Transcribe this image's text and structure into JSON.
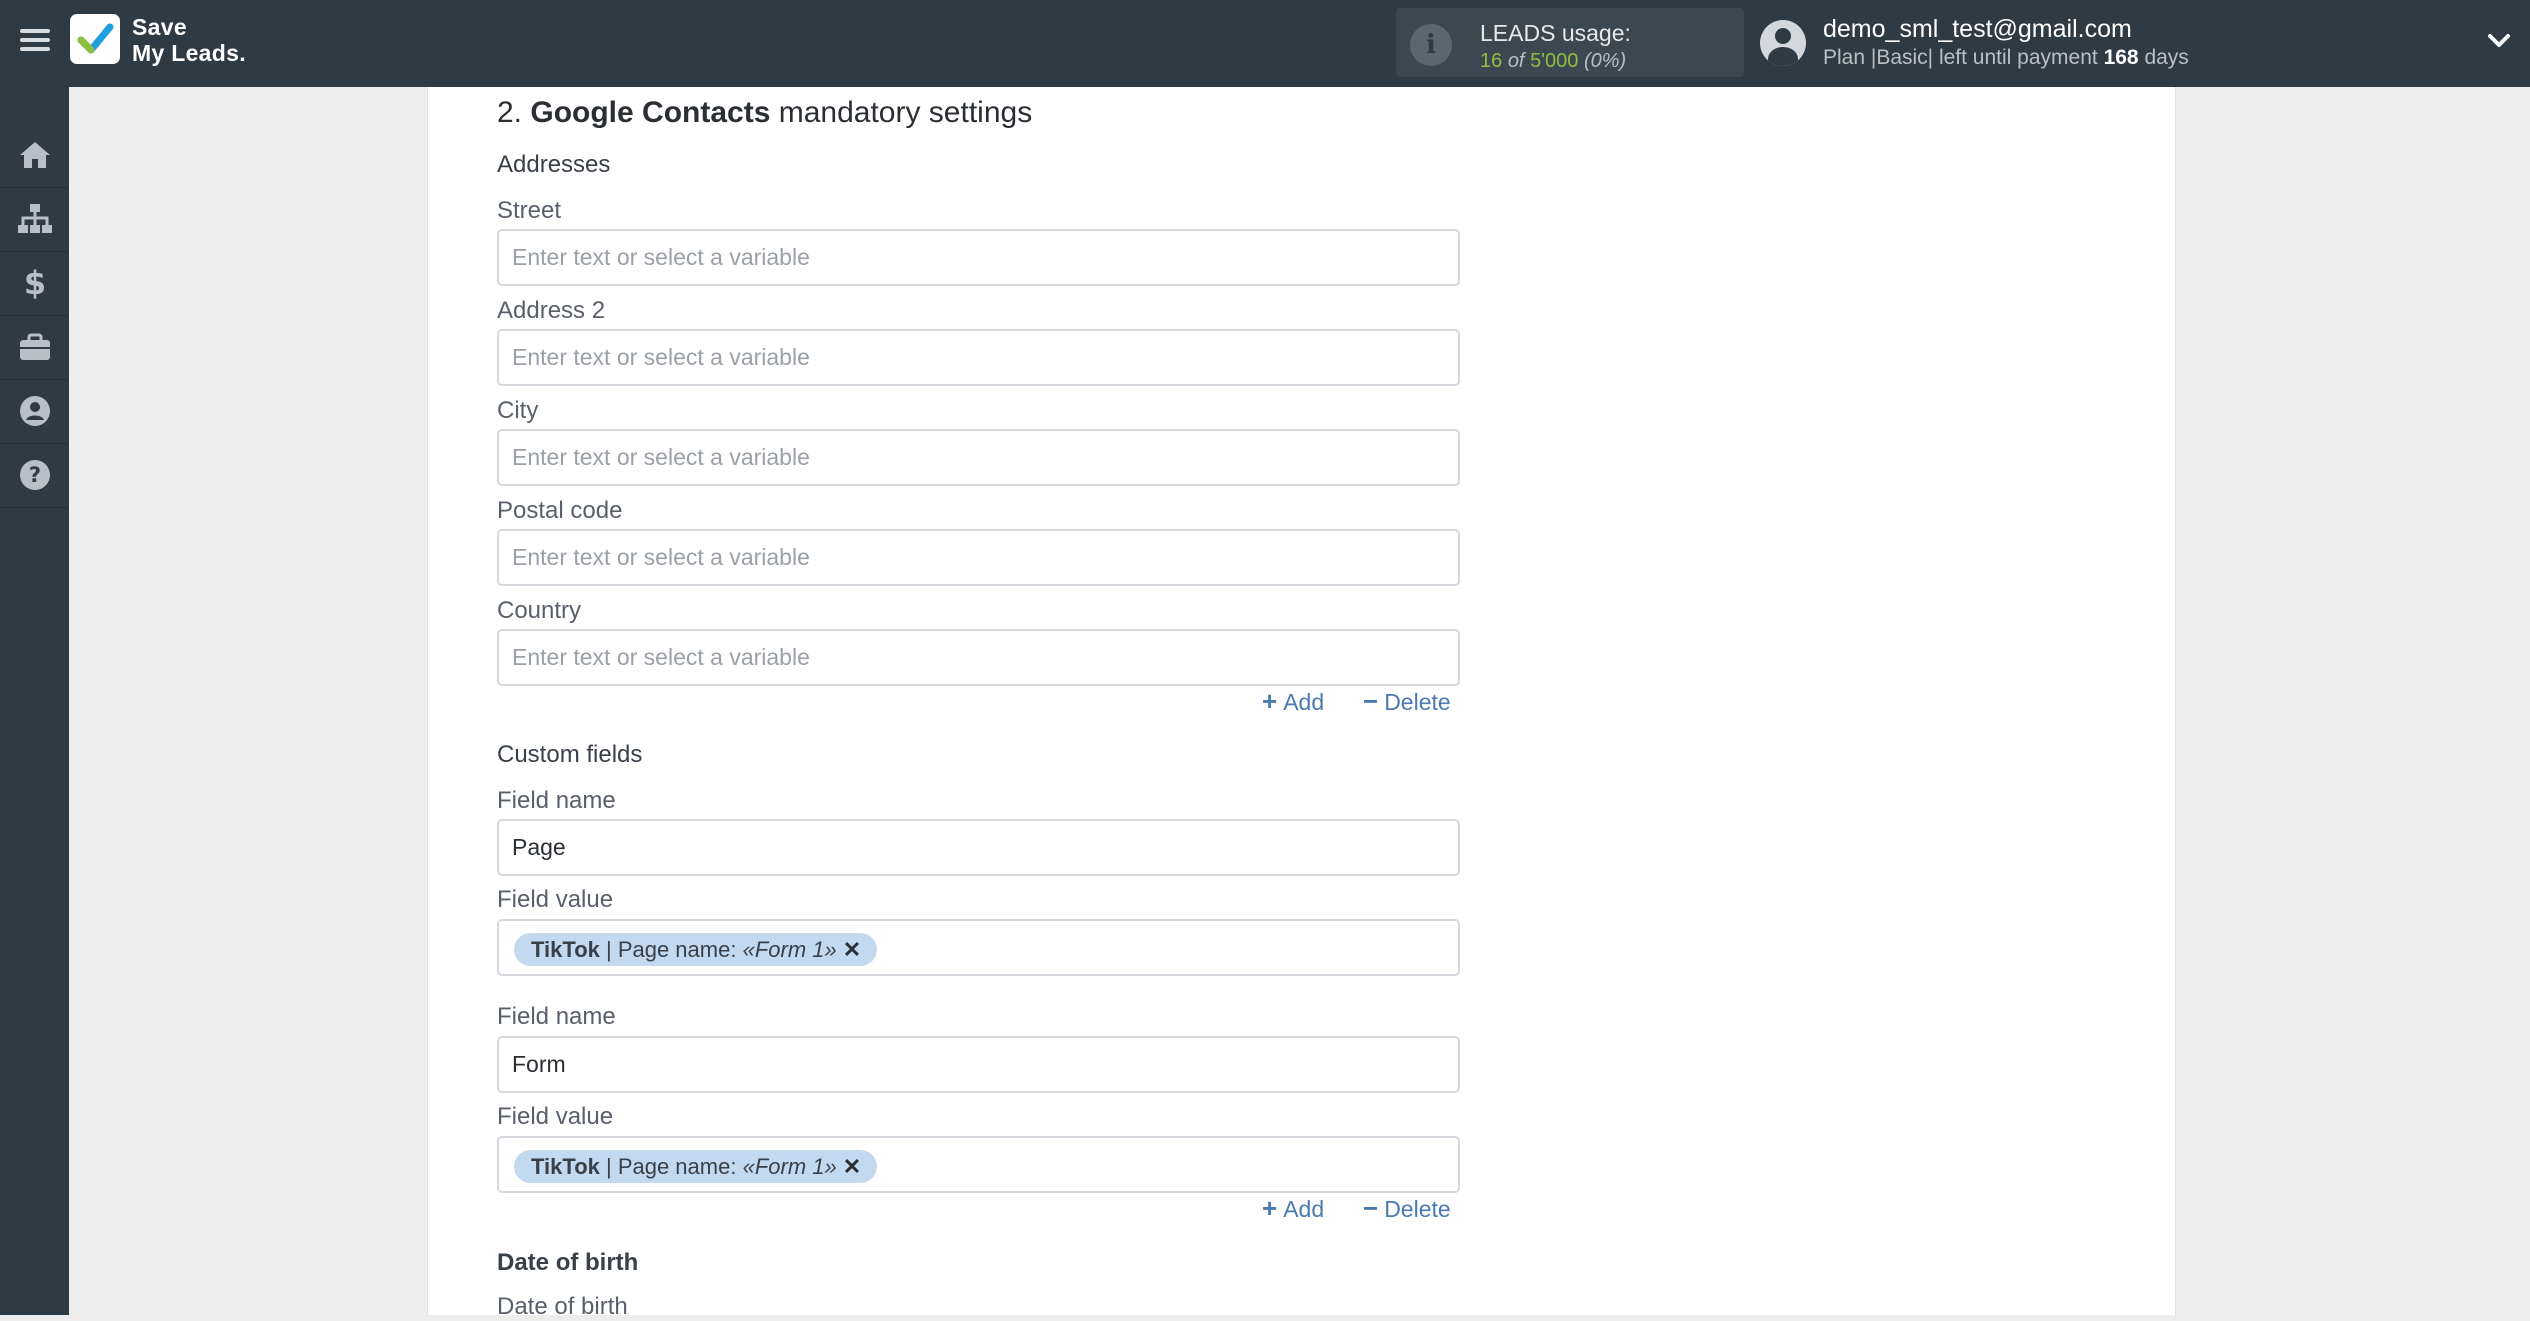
{
  "app": {
    "logo_line1": "Save",
    "logo_line2": "My Leads.",
    "accent": "#8fbf3f",
    "topbar_bg": "#2e3a44"
  },
  "usage": {
    "title": "LEADS usage:",
    "used": "16",
    "of_word": "of",
    "limit": "5'000",
    "percent": "(0%)"
  },
  "user": {
    "email": "demo_sml_test@gmail.com",
    "plan_prefix": "Plan |Basic| left until payment",
    "days": "168",
    "days_suffix": "days"
  },
  "sidebar": {
    "items": [
      "home-icon",
      "sitemap-icon",
      "dollar-icon",
      "briefcase-icon",
      "user-circle-icon",
      "help-icon"
    ]
  },
  "section": {
    "number": "2.",
    "service": "Google Contacts",
    "suffix": "mandatory settings"
  },
  "addresses": {
    "heading": "Addresses",
    "fields": [
      {
        "label": "Street",
        "placeholder": "Enter text or select a variable"
      },
      {
        "label": "Address 2",
        "placeholder": "Enter text or select a variable"
      },
      {
        "label": "City",
        "placeholder": "Enter text or select a variable"
      },
      {
        "label": "Postal code",
        "placeholder": "Enter text or select a variable"
      },
      {
        "label": "Country",
        "placeholder": "Enter text or select a variable"
      }
    ]
  },
  "actions": {
    "add": "Add",
    "delete": "Delete"
  },
  "custom_fields": {
    "heading": "Custom fields",
    "items": [
      {
        "name_label": "Field name",
        "name_value": "Page",
        "value_label": "Field value",
        "tag": {
          "source": "TikTok",
          "sep": " | Page name: ",
          "value": "«Form 1»"
        }
      },
      {
        "name_label": "Field name",
        "name_value": "Form",
        "value_label": "Field value",
        "tag": {
          "source": "TikTok",
          "sep": " | Page name: ",
          "value": "«Form 1»"
        }
      }
    ]
  },
  "date_of_birth": {
    "heading": "Date of birth",
    "label": "Date of birth"
  }
}
